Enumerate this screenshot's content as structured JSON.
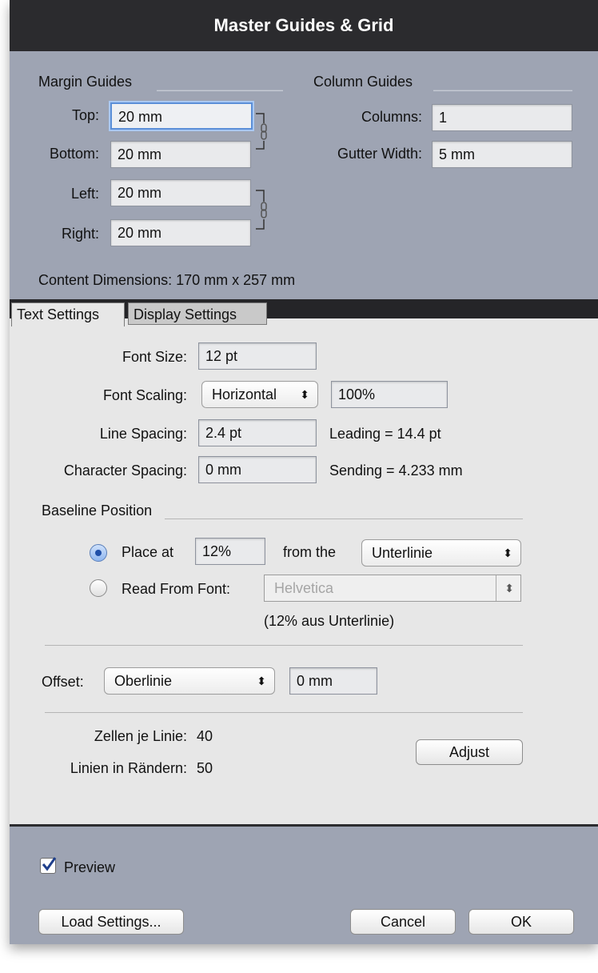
{
  "window": {
    "title": "Master Guides & Grid"
  },
  "margin_guides": {
    "heading": "Margin Guides",
    "top_label": "Top:",
    "top_value": "20 mm",
    "bottom_label": "Bottom:",
    "bottom_value": "20 mm",
    "left_label": "Left:",
    "left_value": "20 mm",
    "right_label": "Right:",
    "right_value": "20 mm"
  },
  "column_guides": {
    "heading": "Column Guides",
    "columns_label": "Columns:",
    "columns_value": "1",
    "gutter_label": "Gutter Width:",
    "gutter_value": "5 mm"
  },
  "content_dimensions": "Content Dimensions:  170 mm x 257 mm",
  "tabs": [
    {
      "label": "Text Settings",
      "active": true
    },
    {
      "label": "Display Settings",
      "active": false
    }
  ],
  "text_settings": {
    "font_size_label": "Font Size:",
    "font_size_value": "12 pt",
    "font_scaling_label": "Font Scaling:",
    "font_scaling_mode": "Horizontal",
    "font_scaling_value": "100%",
    "line_spacing_label": "Line Spacing:",
    "line_spacing_value": "2.4 pt",
    "leading_text": "Leading  =  14.4 pt",
    "char_spacing_label": "Character Spacing:",
    "char_spacing_value": "0 mm",
    "sending_text": "Sending  =  4.233 mm"
  },
  "baseline": {
    "heading": "Baseline Position",
    "place_at_label": "Place at",
    "place_at_value": "12%",
    "from_the_label": "from the",
    "from_the_option": "Unterlinie",
    "read_from_font_label": "Read From Font:",
    "font_option": "Helvetica",
    "note": "(12% aus Unterlinie)",
    "selected": "place_at"
  },
  "offset": {
    "label": "Offset:",
    "option": "Oberlinie",
    "value": "0 mm"
  },
  "cells": {
    "zellen_label": "Zellen je Linie:",
    "zellen_value": "40",
    "linien_label": "Linien in Rändern:",
    "linien_value": "50",
    "adjust_button": "Adjust"
  },
  "footer": {
    "preview_label": "Preview",
    "preview_checked": true,
    "load_button": "Load Settings...",
    "cancel_button": "Cancel",
    "ok_button": "OK"
  },
  "colors": {
    "dialog_bg": "#9ea4b3",
    "panel_bg": "#e7e7e7",
    "titlebar": "#2b2b2e",
    "focus": "#5b8fd8"
  }
}
